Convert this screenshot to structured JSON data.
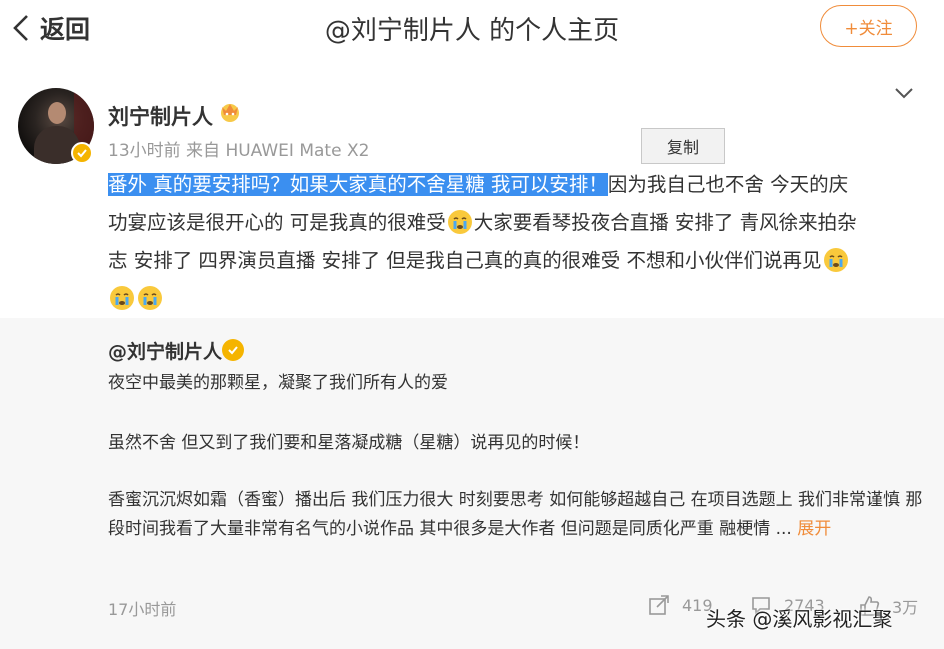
{
  "header": {
    "back_label": "返回",
    "title": "@刘宁制片人 的个人主页",
    "follow_label": "+关注"
  },
  "post": {
    "username": "刘宁制片人",
    "meta": "13小时前  来自 HUAWEI Mate X2",
    "copy_label": "复制",
    "text_selected": "番外 真的要安排吗？如果大家真的不舍星糖 我可以安排！",
    "text_line1_rest": "因为我自己也不舍 今天的庆",
    "text_line2a": "功宴应该是很开心的 可是我真的很难受",
    "text_line2b": "大家要看琴投夜合直播 安排了 青风徐来拍杂",
    "text_line3": "志 安排了 四界演员直播 安排了 但是我自己真的真的很难受 不想和小伙伴们说再见"
  },
  "repost": {
    "username": "@刘宁制片人",
    "line1": "夜空中最美的那颗星，凝聚了我们所有人的爱",
    "line2": "虽然不舍 但又到了我们要和星落凝成糖（星糖）说再见的时候！",
    "para": "香蜜沉沉烬如霜（香蜜）播出后 我们压力很大 时刻要思考 如何能够超越自己 在项目选题上 我们非常谨慎 那段时间我看了大量非常有名气的小说作品 其中很多是大作者 但问题是同质化严重 融梗情 ... ",
    "expand_label": "展开",
    "time": "17小时前",
    "share_count": "419",
    "comment_count": "2743",
    "like_count": "3万"
  },
  "watermark": "头条 @溪风影视汇聚",
  "colors": {
    "accent": "#f08c3a",
    "selection": "#3b8ff0",
    "badge": "#f5b400"
  }
}
